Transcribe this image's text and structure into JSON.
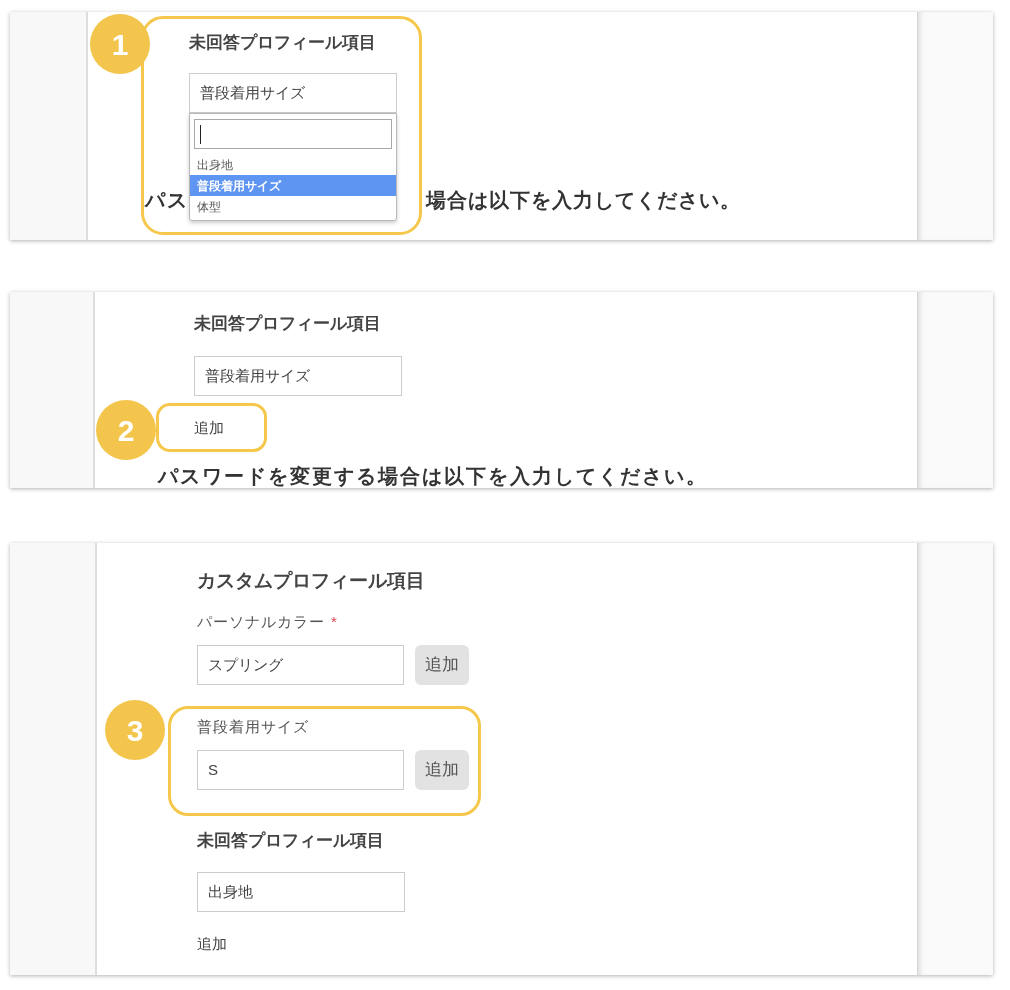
{
  "steps": [
    {
      "kind": "dropdown",
      "badge": "1",
      "heading": "未回答プロフィール項目",
      "select": {
        "value": "普段着用サイズ",
        "expanded": true
      },
      "search": {
        "focused": true
      },
      "options": [
        {
          "label": "出身地",
          "selected": false
        },
        {
          "label": "普段着用サイズ",
          "selected": true
        },
        {
          "label": "体型",
          "selected": false
        }
      ],
      "covered_heading": [
        "パス",
        "場合は以下を入力してください。"
      ]
    },
    {
      "kind": "add_link",
      "badge": "2",
      "heading": "未回答プロフィール項目",
      "select": {
        "value": "普段着用サイズ"
      },
      "add_link": "追加",
      "next_heading": "パスワードを変更する場合は以下を入力してください。"
    },
    {
      "kind": "custom_fields",
      "badge": "3",
      "heading": "カスタムプロフィール項目",
      "fields": [
        {
          "label": "パーソナルカラー",
          "required_mark": "*",
          "value": "スプリング",
          "button": "追加",
          "highlighted": false
        },
        {
          "label": "普段着用サイズ",
          "value": "S",
          "button": "追加",
          "highlighted": true
        }
      ],
      "unanswered": {
        "heading": "未回答プロフィール項目",
        "select": {
          "value": "出身地"
        },
        "add_link": "追加"
      }
    }
  ]
}
